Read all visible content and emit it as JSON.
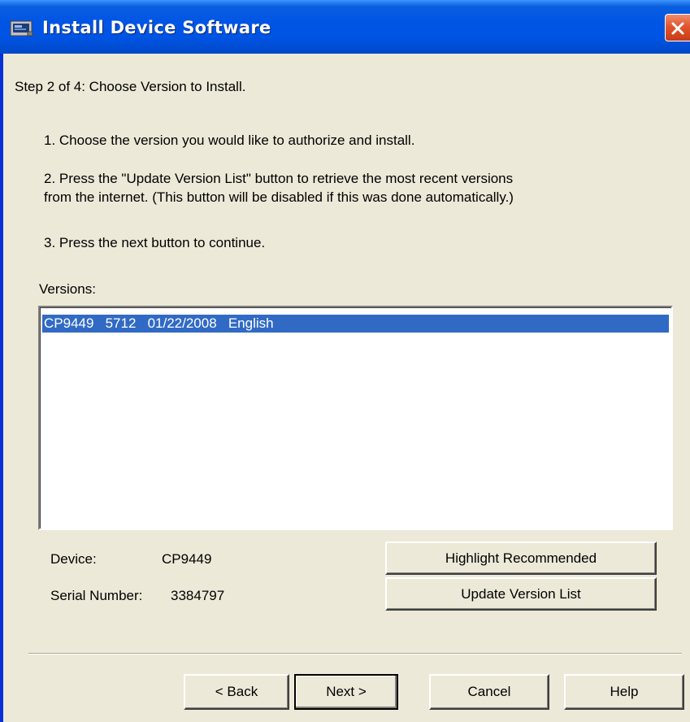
{
  "window": {
    "title": "Install Device Software"
  },
  "step": {
    "heading": "Step 2 of 4:  Choose Version to Install."
  },
  "instructions": {
    "item1": "1.  Choose the version you would like to authorize and install.",
    "item2_line1": "2.  Press the \"Update Version List\" button to retrieve the most recent versions",
    "item2_line2": "from the internet.  (This button will be disabled if this was done automatically.)",
    "item3": "3.  Press the next button to continue."
  },
  "versions": {
    "label": "Versions:",
    "items": [
      {
        "text": "CP9449   5712   01/22/2008   English",
        "selected": true
      }
    ]
  },
  "device_info": {
    "device_label": "Device:",
    "device_value": "CP9449",
    "serial_label": "Serial Number:",
    "serial_value": "3384797"
  },
  "actions": {
    "highlight_recommended": "Highlight Recommended",
    "update_version_list": "Update Version List"
  },
  "footer": {
    "back": "< Back",
    "next": "Next >",
    "cancel": "Cancel",
    "help": "Help"
  },
  "colors": {
    "titlebar": "#0054e3",
    "selection": "#316ac5",
    "dialog_background": "#ece9d8",
    "close_button": "#e1552f"
  },
  "icons": {
    "title": "install-software-icon",
    "close": "close-icon"
  }
}
